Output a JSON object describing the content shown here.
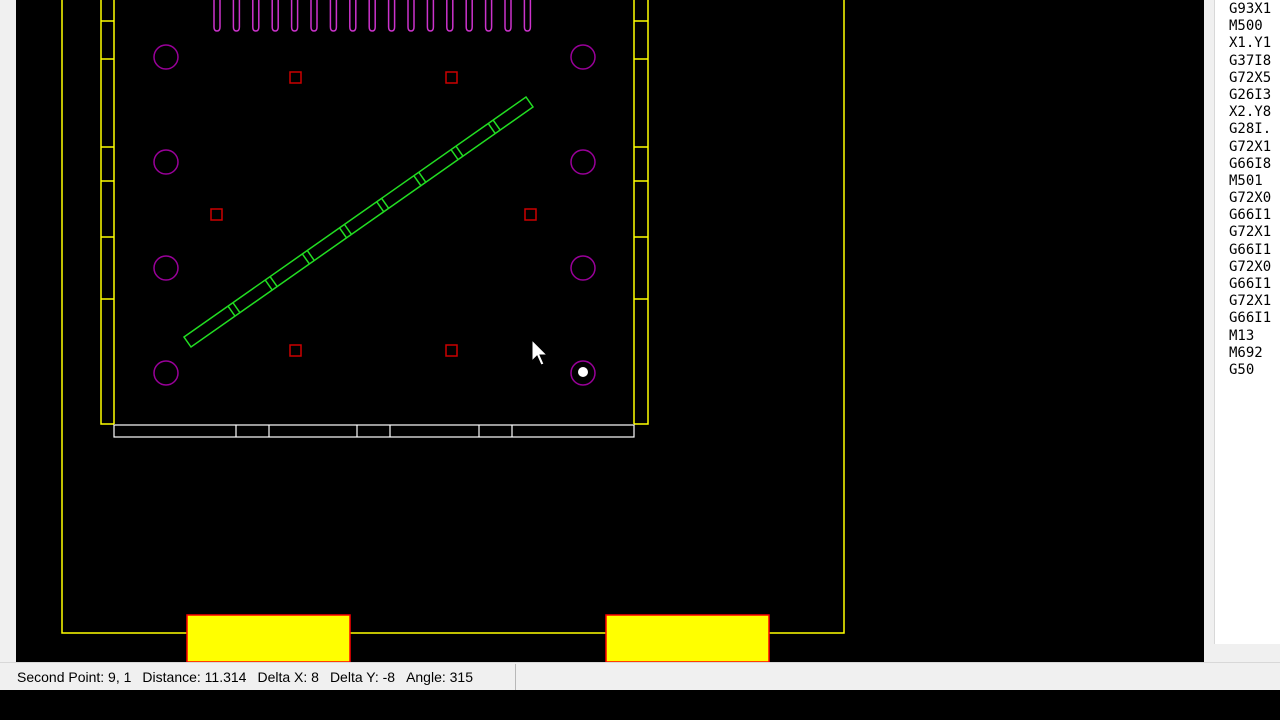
{
  "viewport": {
    "background": "#000000",
    "colors": {
      "sheet_outline": "#ffff00",
      "clamp": "#ffff00",
      "clamp_border": "#ff0000",
      "part_outline": "#ffff00",
      "circle_holes": "#990099",
      "comb_tabs": "#cc33cc",
      "square_holes": "#cc0000",
      "slot_bar": "#22dd22",
      "bottom_tab_bar": "#ffffff",
      "selected_point": "#ffffff"
    },
    "cursor_icon": "arrow-pointer-icon"
  },
  "nc_panel": {
    "lines": [
      "G93X1",
      "M500",
      "X1.Y1",
      "G37I8",
      "G72X5",
      "G26I3",
      "X2.Y8",
      "G28I.",
      "G72X1",
      "G66I8",
      "M501",
      "G72X0",
      "G66I1",
      "G72X1",
      "G66I1",
      "G72X0",
      "G66I1",
      "G72X1",
      "G66I1",
      "M13",
      "M692",
      "G50"
    ]
  },
  "status_bar": {
    "second_point": "Second Point: 9, 1",
    "distance": "Distance: 11.314",
    "delta_x": "Delta X: 8",
    "delta_y": "Delta Y: -8",
    "angle": "Angle: 315"
  }
}
